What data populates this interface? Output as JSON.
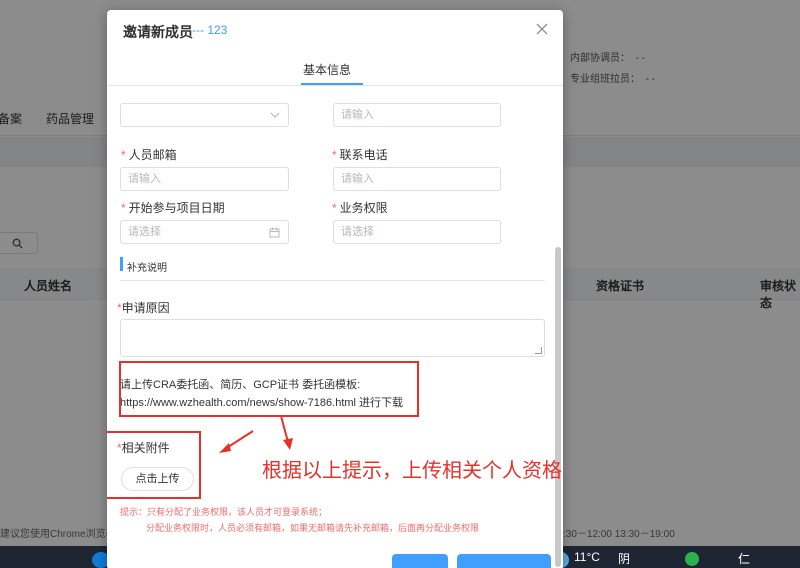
{
  "background": {
    "info_labels": [
      "内部协调员：",
      "专业组班拉员："
    ],
    "info_values": [
      "- -",
      "- -"
    ],
    "tabs": [
      "备案",
      "药品管理"
    ],
    "search_icon": "search-icon",
    "table_headers": [
      "人员姓名",
      "资格证书",
      "审核状态"
    ],
    "footer_left": "建议您使用Chrome浏览器",
    "footer_right": ":30－12:00 13:30－19:00"
  },
  "taskbar": {
    "weather": "11°C",
    "weather_suffix": "阴",
    "ime": "仁"
  },
  "dialog": {
    "title": "邀请新成员",
    "subtitle": "--- 123",
    "close_icon": "close-icon",
    "tab": "基本信息",
    "fields": {
      "row0": {
        "left_placeholder": "",
        "right_placeholder": "请输入"
      },
      "email": {
        "label": "人员邮箱",
        "placeholder": "请输入"
      },
      "phone": {
        "label": "联系电话",
        "placeholder": "请输入"
      },
      "start_date": {
        "label": "开始参与项目日期",
        "placeholder": "请选择"
      },
      "permission": {
        "label": "业务权限",
        "placeholder": "请选择"
      }
    },
    "section_title": "补充说明",
    "reason_label": "申请原因",
    "hint_line1": "请上传CRA委托函、简历、GCP证书 委托函模板:",
    "hint_line2": "https://www.wzhealth.com/news/show-7186.html 进行下载",
    "attachment_label": "相关附件",
    "upload_button": "点击上传",
    "tip_line1": "提示：只有分配了业务权限，该人员才可登录系统；",
    "tip_line2": "分配业务权限时，人员必须有邮箱，如果无邮箱请先补充邮箱，后面再分配业务权限",
    "annotation": "根据以上提示，上传相关个人资格文件"
  },
  "colors": {
    "primary": "#409eff",
    "required": "#f56c6c",
    "annotation_red": "#e8302a"
  }
}
